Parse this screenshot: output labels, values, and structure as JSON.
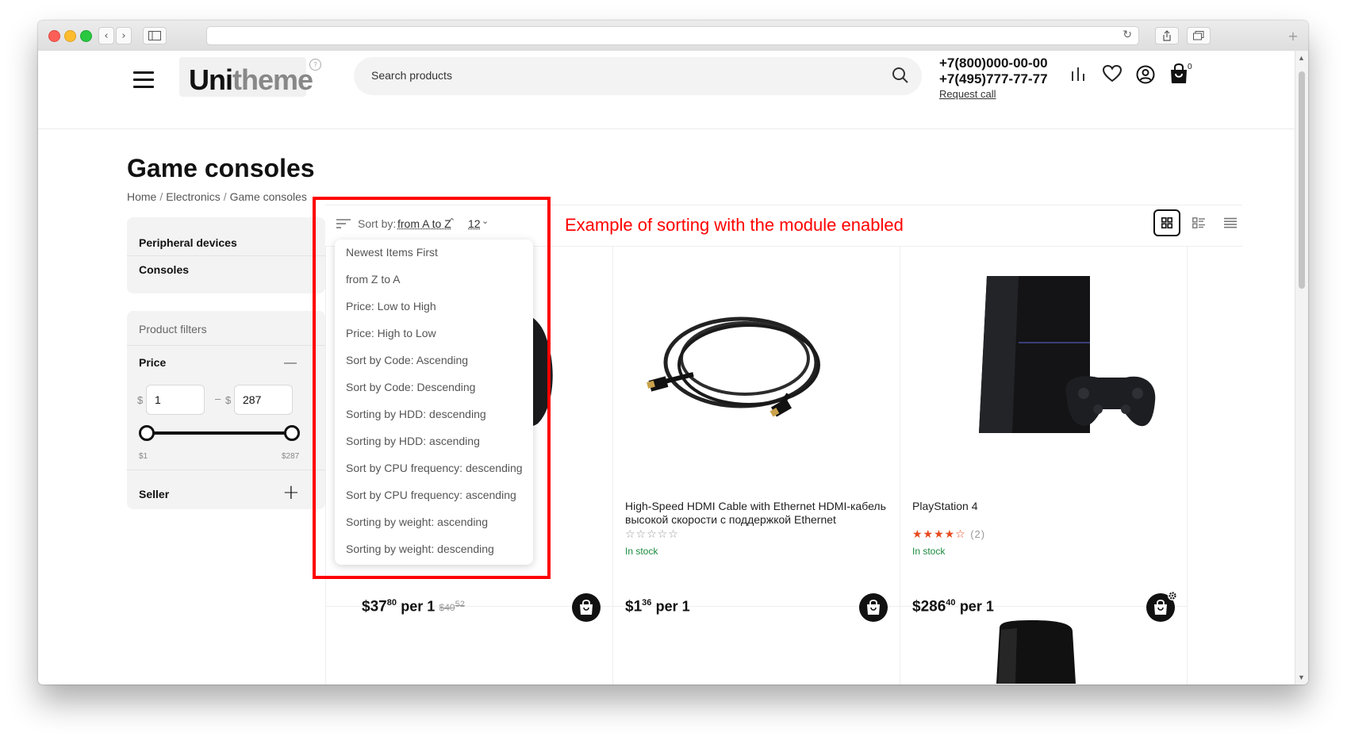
{
  "browser": {
    "reload_glyph": "↻",
    "back_glyph": "‹",
    "forward_glyph": "›"
  },
  "header": {
    "logo_part1": "Uni",
    "logo_part2": "theme",
    "logo_mark": "?",
    "search_placeholder": "Search products",
    "phone1": "+7(800)000-00-00",
    "phone2": "+7(495)777-77-77",
    "request_call": "Request call",
    "cart_count": "0"
  },
  "page": {
    "title": "Game consoles",
    "breadcrumb": [
      "Home",
      "Electronics",
      "Game consoles"
    ],
    "breadcrumb_sep": "/"
  },
  "sidebar": {
    "categories": [
      "Peripheral devices",
      "Consoles"
    ],
    "filters_heading": "Product filters",
    "price_label": "Price",
    "collapse_glyph": "—",
    "currency": "$",
    "range_dash": "–",
    "price_min": "1",
    "price_max": "287",
    "price_min_label": "$1",
    "price_max_label": "$287",
    "seller_label": "Seller",
    "expand_glyph": "+"
  },
  "sort": {
    "label": "Sort by:",
    "current": "from A to Z",
    "caret": "⌃",
    "per_page": "12",
    "per_page_caret": "⌄",
    "options": [
      "Newest Items First",
      "from Z to A",
      "Price: Low to High",
      "Price: High to Low",
      "Sort by Code: Ascending",
      "Sort by Code: Descending",
      "Sorting by HDD: descending",
      "Sorting by HDD: ascending",
      "Sort by CPU frequency: descending",
      "Sort by CPU frequency: ascending",
      "Sorting by weight: ascending",
      "Sorting by weight: descending"
    ]
  },
  "annotation": "Example of sorting with the module enabled",
  "products": [
    {
      "price_main": "$37",
      "price_cents": "80",
      "price_per": "per 1",
      "old_main": "$40",
      "old_cents": "52"
    },
    {
      "name": "High-Speed HDMI Cable with Ethernet HDMI-кабель высокой скорости с поддержкой Ethernet",
      "stars": "☆☆☆☆☆",
      "stock": "In stock",
      "price_main": "$1",
      "price_cents": "36",
      "price_per": "per 1"
    },
    {
      "name": "PlayStation 4",
      "stars": "★★★★☆",
      "reviews": "(2)",
      "stock": "In stock",
      "price_main": "$286",
      "price_cents": "40",
      "price_per": "per 1",
      "rating": 4
    }
  ],
  "colors": {
    "accent_red": "#ff0000",
    "stock_green": "#1a8a3e",
    "star_orange": "#e8491d"
  }
}
